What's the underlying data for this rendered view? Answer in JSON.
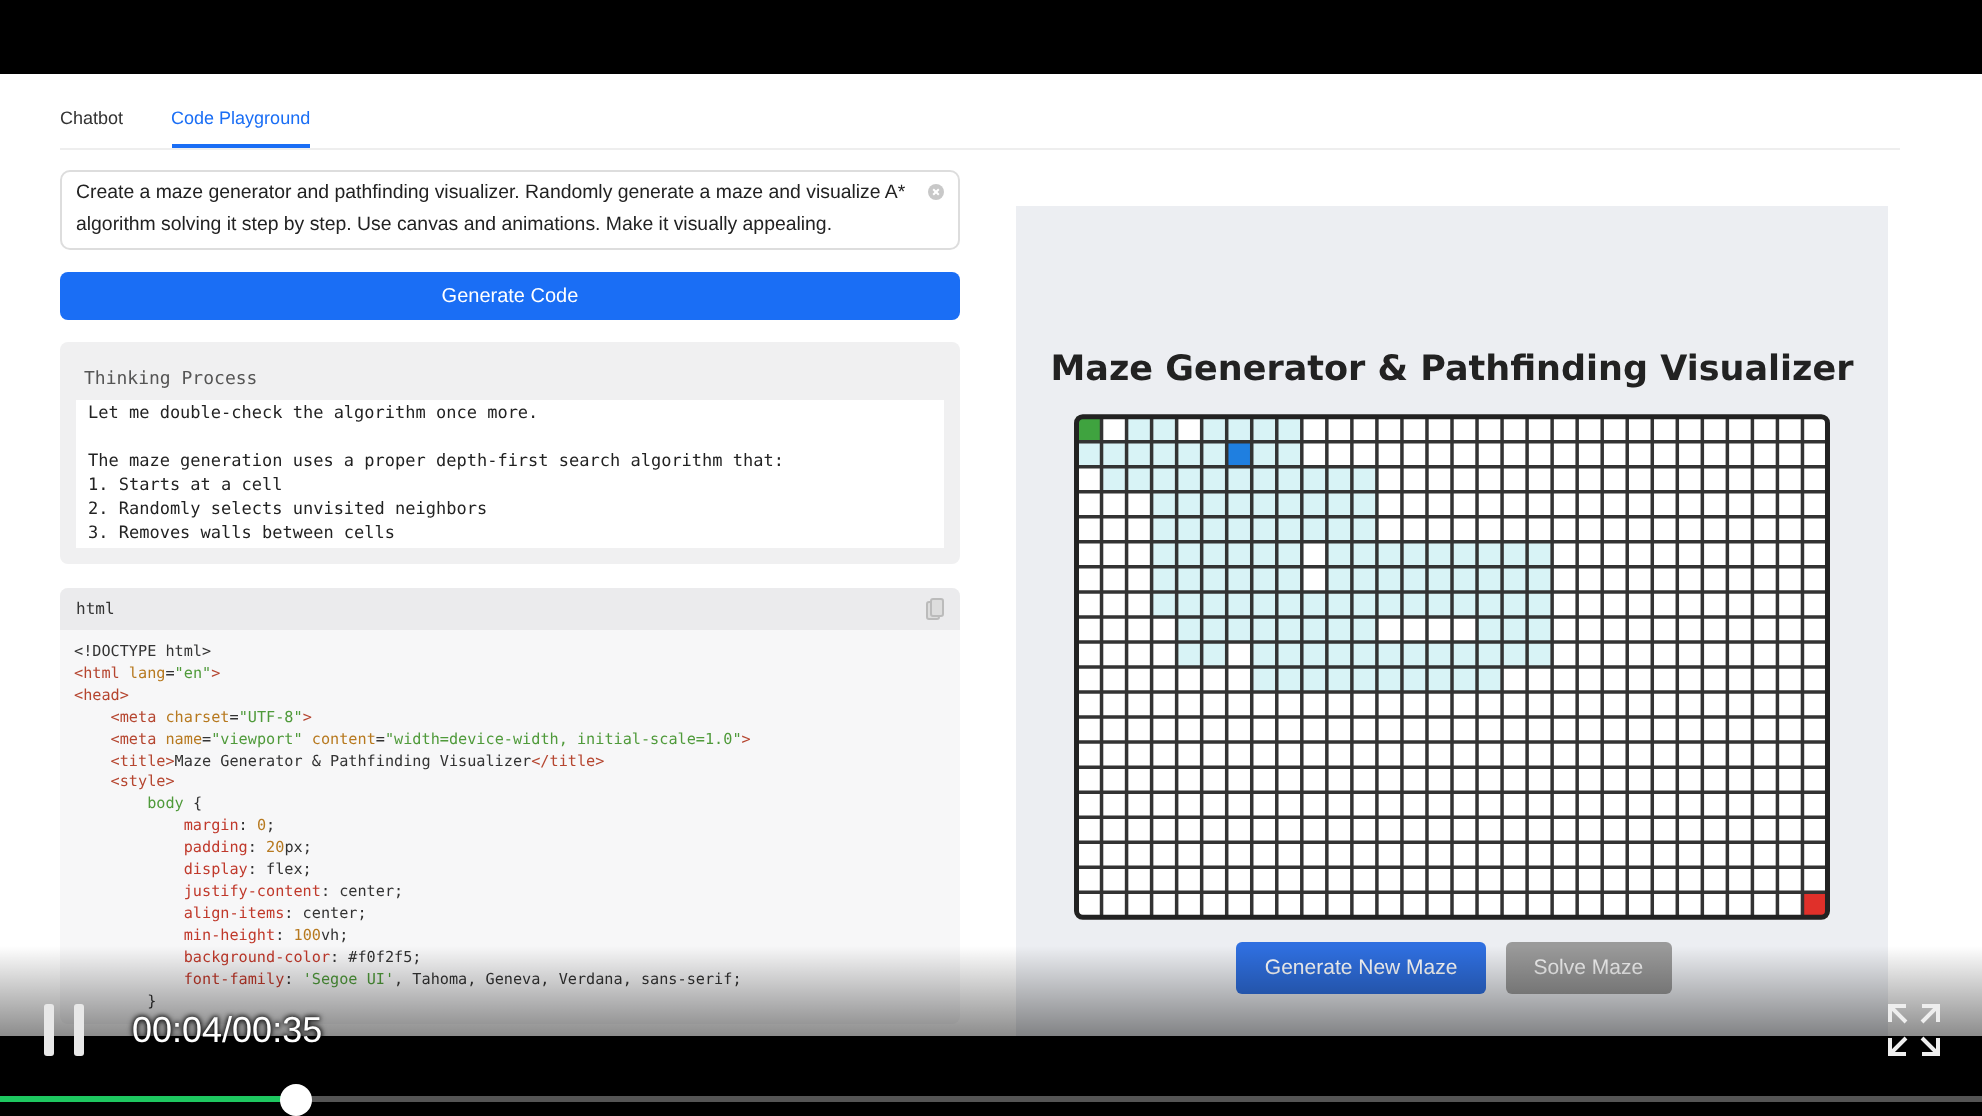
{
  "tabs": [
    {
      "label": "Chatbot",
      "selected": false
    },
    {
      "label": "Code Playground",
      "selected": true
    }
  ],
  "prompt": {
    "value": "Create a maze generator and pathfinding visualizer. Randomly generate a maze and visualize A* algorithm solving it step by step. Use canvas and animations. Make it visually appealing."
  },
  "generate_button": "Generate Code",
  "thinking": {
    "title": "Thinking Process",
    "paragraphs": [
      [
        "Let me double-check the algorithm once more."
      ],
      [
        "The maze generation uses a proper depth-first search algorithm that:",
        "1. Starts at a cell",
        "2. Randomly selects unvisited neighbors",
        "3. Removes walls between cells"
      ]
    ]
  },
  "code_block": {
    "language": "html",
    "lines": [
      [
        {
          "text": "<!DOCTYPE html>",
          "kind": "plain"
        }
      ],
      [
        {
          "text": "<html",
          "kind": "tag"
        },
        {
          "text": " lang",
          "kind": "attr"
        },
        {
          "text": "=",
          "kind": "plain"
        },
        {
          "text": "\"en\"",
          "kind": "string"
        },
        {
          "text": ">",
          "kind": "tag"
        }
      ],
      [
        {
          "text": "<head>",
          "kind": "tag"
        }
      ],
      [
        {
          "text": "    <meta",
          "kind": "tag"
        },
        {
          "text": " charset",
          "kind": "attr"
        },
        {
          "text": "=",
          "kind": "plain"
        },
        {
          "text": "\"UTF-8\"",
          "kind": "string"
        },
        {
          "text": ">",
          "kind": "tag"
        }
      ],
      [
        {
          "text": "    <meta",
          "kind": "tag"
        },
        {
          "text": " name",
          "kind": "attr"
        },
        {
          "text": "=",
          "kind": "plain"
        },
        {
          "text": "\"viewport\"",
          "kind": "string"
        },
        {
          "text": " content",
          "kind": "attr"
        },
        {
          "text": "=",
          "kind": "plain"
        },
        {
          "text": "\"width=device-width, initial-scale=1.0\"",
          "kind": "string"
        },
        {
          "text": ">",
          "kind": "tag"
        }
      ],
      [
        {
          "text": "    <title>",
          "kind": "tag"
        },
        {
          "text": "Maze Generator & Pathfinding Visualizer",
          "kind": "plain"
        },
        {
          "text": "</title>",
          "kind": "tag"
        }
      ],
      [
        {
          "text": "    <style>",
          "kind": "tag"
        }
      ],
      [
        {
          "text": "        body",
          "kind": "selector"
        },
        {
          "text": " {",
          "kind": "plain"
        }
      ],
      [
        {
          "text": "            margin",
          "kind": "prop"
        },
        {
          "text": ": ",
          "kind": "plain"
        },
        {
          "text": "0",
          "kind": "number"
        },
        {
          "text": ";",
          "kind": "plain"
        }
      ],
      [
        {
          "text": "            padding",
          "kind": "prop"
        },
        {
          "text": ": ",
          "kind": "plain"
        },
        {
          "text": "20",
          "kind": "number"
        },
        {
          "text": "px;",
          "kind": "plain"
        }
      ],
      [
        {
          "text": "            display",
          "kind": "prop"
        },
        {
          "text": ": flex;",
          "kind": "plain"
        }
      ],
      [
        {
          "text": "            justify-content",
          "kind": "prop"
        },
        {
          "text": ": center;",
          "kind": "plain"
        }
      ],
      [
        {
          "text": "            align-items",
          "kind": "prop"
        },
        {
          "text": ": center;",
          "kind": "plain"
        }
      ],
      [
        {
          "text": "            min-height",
          "kind": "prop"
        },
        {
          "text": ": ",
          "kind": "plain"
        },
        {
          "text": "100",
          "kind": "number"
        },
        {
          "text": "vh;",
          "kind": "plain"
        }
      ],
      [
        {
          "text": "            background-color",
          "kind": "prop"
        },
        {
          "text": ": #f0f2f5;",
          "kind": "plain"
        }
      ],
      [
        {
          "text": "            font-family",
          "kind": "prop"
        },
        {
          "text": ": ",
          "kind": "plain"
        },
        {
          "text": "'Segoe UI'",
          "kind": "string"
        },
        {
          "text": ", Tahoma, Geneva, Verdana, sans-serif;",
          "kind": "plain"
        }
      ],
      [
        {
          "text": "        }",
          "kind": "plain"
        }
      ]
    ]
  },
  "preview": {
    "title": "Maze Generator & Pathfinding Visualizer",
    "buttons": [
      {
        "label": "Generate New Maze",
        "disabled": false
      },
      {
        "label": "Solve Maze",
        "disabled": true
      }
    ]
  },
  "player": {
    "playing": true,
    "time": "00:04/00:35",
    "level": 0.15
  }
}
